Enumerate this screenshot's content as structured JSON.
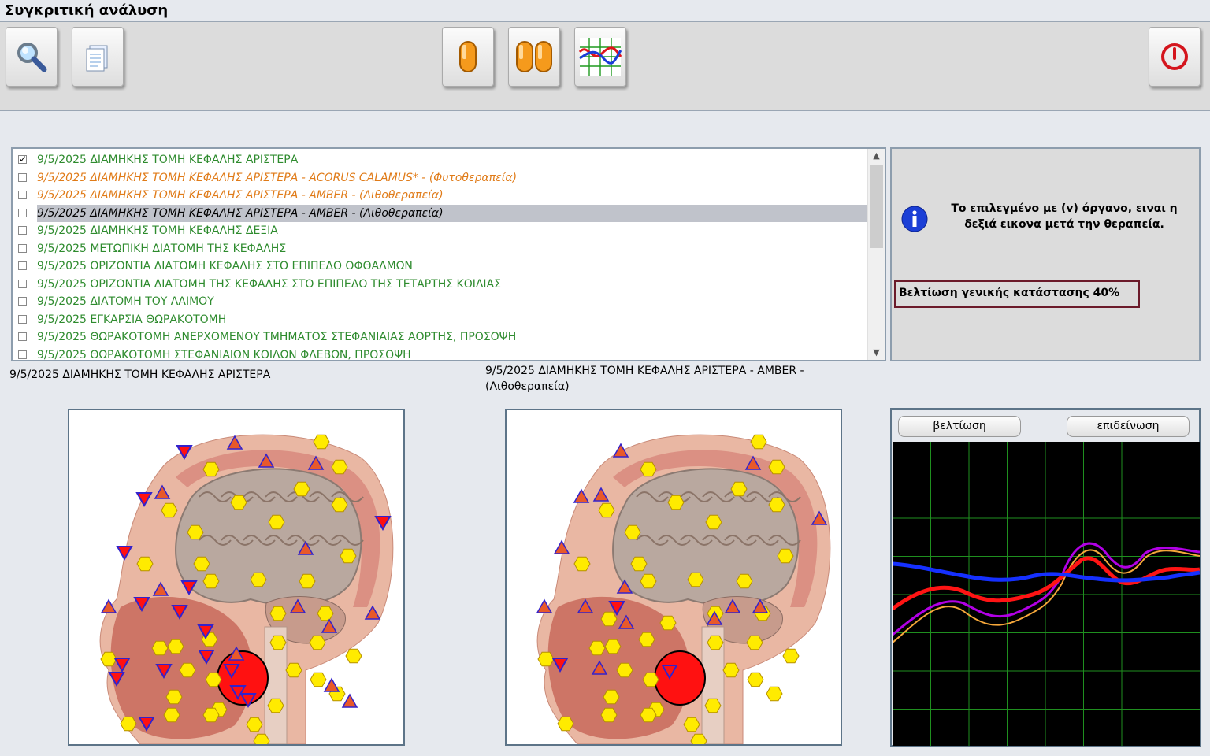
{
  "window": {
    "title": "Συγκριτική ανάλυση"
  },
  "toolbar": {
    "buttons": [
      {
        "name": "search-button",
        "icon": "magnifier-icon"
      },
      {
        "name": "report-button",
        "icon": "document-icon"
      },
      {
        "name": "single-view-button",
        "icon": "single-capsule-icon"
      },
      {
        "name": "compare-view-button",
        "icon": "double-capsule-icon"
      },
      {
        "name": "graph-button",
        "icon": "graph-icon"
      },
      {
        "name": "exit-button",
        "icon": "power-icon"
      }
    ]
  },
  "list": {
    "items": [
      {
        "checked": true,
        "text": "9/5/2025  ΔΙΑΜΗΚΗΣ ΤΟΜΗ ΚΕΦΑΛΗΣ ΑΡΙΣΤΕΡΑ",
        "color": "#2e8b2e",
        "italic": false,
        "selected": false
      },
      {
        "checked": false,
        "text": "9/5/2025  ΔΙΑΜΗΚΗΣ ΤΟΜΗ ΚΕΦΑΛΗΣ ΑΡΙΣΤΕΡΑ - ACORUS  CALAMUS* - (Φυτοθεραπεία)",
        "color": "#e07b18",
        "italic": true,
        "selected": false
      },
      {
        "checked": false,
        "text": "9/5/2025  ΔΙΑΜΗΚΗΣ ΤΟΜΗ ΚΕΦΑΛΗΣ ΑΡΙΣΤΕΡΑ - AMBER - (Λιθοθεραπεία)",
        "color": "#e07b18",
        "italic": true,
        "selected": false
      },
      {
        "checked": false,
        "text": "9/5/2025  ΔΙΑΜΗΚΗΣ ΤΟΜΗ ΚΕΦΑΛΗΣ ΑΡΙΣΤΕΡΑ - AMBER - (Λιθοθεραπεία)",
        "color": "#000000",
        "italic": true,
        "selected": true
      },
      {
        "checked": false,
        "text": "9/5/2025  ΔΙΑΜΗΚΗΣ ΤΟΜΗ ΚΕΦΑΛΗΣ ΔΕΞΙΑ",
        "color": "#2e8b2e",
        "italic": false,
        "selected": false
      },
      {
        "checked": false,
        "text": "9/5/2025  ΜΕΤΩΠΙΚΗ ΔΙΑΤΟΜΗ ΤΗΣ ΚΕΦΑΛΗΣ",
        "color": "#2e8b2e",
        "italic": false,
        "selected": false
      },
      {
        "checked": false,
        "text": "9/5/2025  ΟΡΙΖΟΝΤΙΑ ΔΙΑΤΟΜΗ ΚΕΦΑΛΗΣ ΣΤΟ ΕΠΙΠΕΔΟ ΟΦΘΑΛΜΩΝ",
        "color": "#2e8b2e",
        "italic": false,
        "selected": false
      },
      {
        "checked": false,
        "text": "9/5/2025  ΟΡΙΖΟΝΤΙΑ ΔΙΑΤΟΜΗ ΤΗΣ ΚΕΦΑΛΗΣ ΣΤΟ ΕΠΙΠΕΔΟ ΤΗΣ ΤΕΤΑΡΤΗΣ ΚΟΙΛΙΑΣ",
        "color": "#2e8b2e",
        "italic": false,
        "selected": false
      },
      {
        "checked": false,
        "text": "9/5/2025  ΔΙΑΤΟΜΗ ΤΟΥ ΛΑΙΜΟΥ",
        "color": "#2e8b2e",
        "italic": false,
        "selected": false
      },
      {
        "checked": false,
        "text": "9/5/2025  ΕΓΚΑΡΣΙΑ ΘΩΡΑΚΟΤΟΜΗ",
        "color": "#2e8b2e",
        "italic": false,
        "selected": false
      },
      {
        "checked": false,
        "text": "9/5/2025  ΘΩΡΑΚΟΤΟΜΗ ΑΝΕΡΧΟΜΕΝΟΥ ΤΜΗΜΑΤΟΣ ΣΤΕΦΑΝΙΑΙΑΣ  ΑΟΡΤΗΣ, ΠΡΟΣΟΨΗ",
        "color": "#2e8b2e",
        "italic": false,
        "selected": false
      },
      {
        "checked": false,
        "text": "9/5/2025  ΘΩΡΑΚΟΤΟΜΗ ΣΤΕΦΑΝΙΑΙΩΝ ΚΟΙΛΩΝ ΦΛΕΒΩΝ, ΠΡΟΣΟΨΗ",
        "color": "#2e8b2e",
        "italic": false,
        "selected": false
      }
    ]
  },
  "info": {
    "icon": "info-icon",
    "message": "Το επιλεγμένο με (v) όργανο, ειναι η δεξιά εικονα μετά την θεραπεία.",
    "improvement": "Βελτίωση γενικής κατάστασης 40%"
  },
  "captions": {
    "left": "9/5/2025  ΔΙΑΜΗΚΗΣ ΤΟΜΗ ΚΕΦΑΛΗΣ ΑΡΙΣΤΕΡΑ",
    "right": "9/5/2025  ΔΙΑΜΗΚΗΣ ΤΟΜΗ ΚΕΦΑΛΗΣ ΑΡΙΣΤΕΡΑ - AMBER - (Λιθοθεραπεία)"
  },
  "chart_panel": {
    "improve_label": "βελτίωση",
    "worsen_label": "επιδείνωση",
    "background": "#000000",
    "grid_color": "#1f8f1f"
  },
  "colors": {
    "marker_yellow": "#ffeb00",
    "marker_triangle": "#e8592a",
    "marker_blue": "#3322cc",
    "highlight_red": "#ff1111",
    "improvement_border": "#6b1a2a"
  }
}
